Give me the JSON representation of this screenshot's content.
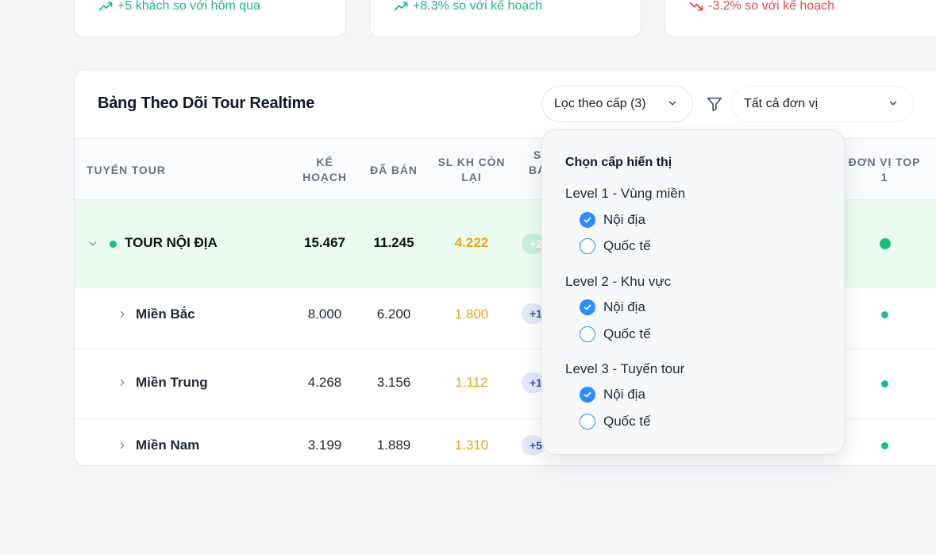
{
  "stats": [
    {
      "trend": "+5 khách so với hôm qua",
      "direction": "up"
    },
    {
      "trend": "+8.3% so với kế hoạch",
      "direction": "up"
    },
    {
      "trend": "-3.2% so với kế hoạch",
      "direction": "down"
    }
  ],
  "panel": {
    "title": "Bảng Theo Dõi Tour Realtime",
    "level_filter_label": "Lọc theo cấp (3)",
    "unit_select_value": "Tất cả đơn vị"
  },
  "table": {
    "headers": {
      "route": "TUYẾN TOUR",
      "plan_1": "KẾ",
      "plan_2": "HOẠCH",
      "sold": "ĐÃ BÁN",
      "remaining_1": "SL KH CÒN",
      "remaining_2": "LẠI",
      "sale_1": "S",
      "sale_2": "BÁ",
      "top_unit_1": "ĐƠN VỊ TOP",
      "top_unit_2": "1"
    },
    "rows": [
      {
        "name": "TOUR NỘI ĐỊA",
        "plan": "15.467",
        "sold": "11.245",
        "remaining": "4.222",
        "badge": "+2"
      },
      {
        "name": "Miền Bắc",
        "plan": "8.000",
        "sold": "6.200",
        "remaining": "1.800",
        "badge": "+1"
      },
      {
        "name": "Miền Trung",
        "plan": "4.268",
        "sold": "3.156",
        "remaining": "1.112",
        "badge": "+1"
      },
      {
        "name": "Miền Nam",
        "plan": "3.199",
        "sold": "1.889",
        "remaining": "1.310",
        "badge": "+5"
      }
    ]
  },
  "dropdown": {
    "title": "Chọn cấp hiển thị",
    "levels": [
      {
        "label": "Level 1 - Vùng miền",
        "options": [
          {
            "label": "Nội địa",
            "checked": true
          },
          {
            "label": "Quốc tế",
            "checked": false
          }
        ]
      },
      {
        "label": "Level 2 - Khu vực",
        "options": [
          {
            "label": "Nội địa",
            "checked": true
          },
          {
            "label": "Quốc tế",
            "checked": false
          }
        ]
      },
      {
        "label": "Level 3 - Tuyến tour",
        "options": [
          {
            "label": "Nội địa",
            "checked": true
          },
          {
            "label": "Quốc tế",
            "checked": false
          }
        ]
      }
    ]
  },
  "colors": {
    "accent_green": "#19c07d",
    "trend_up": "#1fb980",
    "trend_down": "#e5484d",
    "remaining_orange": "#e7a41c",
    "checkbox_blue": "#2d8cff"
  },
  "icons": [
    "trend-up-icon",
    "trend-down-icon",
    "chevron-down-icon",
    "filter-icon",
    "chevron-right-icon",
    "check-icon"
  ]
}
